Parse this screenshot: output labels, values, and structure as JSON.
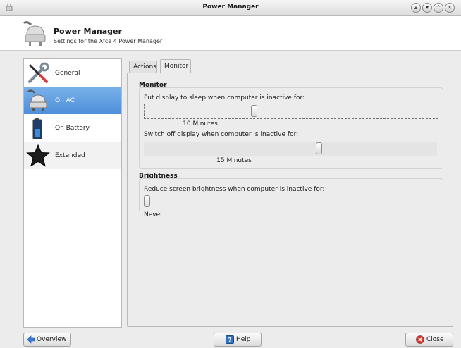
{
  "window": {
    "title": "Power Manager",
    "controls": [
      "minimize-icon",
      "restore-icon",
      "maximize-icon",
      "close-icon"
    ]
  },
  "header": {
    "title": "Power Manager",
    "subtitle": "Settings for the Xfce 4 Power Manager"
  },
  "sidebar": {
    "items": [
      {
        "label": "General",
        "icon": "wrench-screwdriver-icon",
        "selected": false
      },
      {
        "label": "On AC",
        "icon": "ac-plug-icon",
        "selected": true
      },
      {
        "label": "On Battery",
        "icon": "battery-icon",
        "selected": false
      },
      {
        "label": "Extended",
        "icon": "star-icon",
        "selected": false
      }
    ]
  },
  "tabs": [
    {
      "label": "Actions",
      "active": false
    },
    {
      "label": "Monitor",
      "active": true
    }
  ],
  "monitor": {
    "group_title": "Monitor",
    "sleep_label": "Put display to sleep when computer is inactive for:",
    "sleep_value": "10 Minutes",
    "sleep_level": 0.37,
    "off_label": "Switch off display when computer is inactive for:",
    "off_value": "15 Minutes",
    "off_level": 0.6
  },
  "brightness": {
    "group_title": "Brightness",
    "reduce_label": "Reduce screen brightness when computer is inactive for:",
    "reduce_value": "Never",
    "reduce_level": 0.0
  },
  "buttons": {
    "overview": "Overview",
    "help": "Help",
    "close": "Close"
  },
  "colors": {
    "selection": "#4d8fd9",
    "window_bg": "#ececec",
    "close_icon": "#d9332b",
    "help_icon": "#2f6fc0"
  }
}
